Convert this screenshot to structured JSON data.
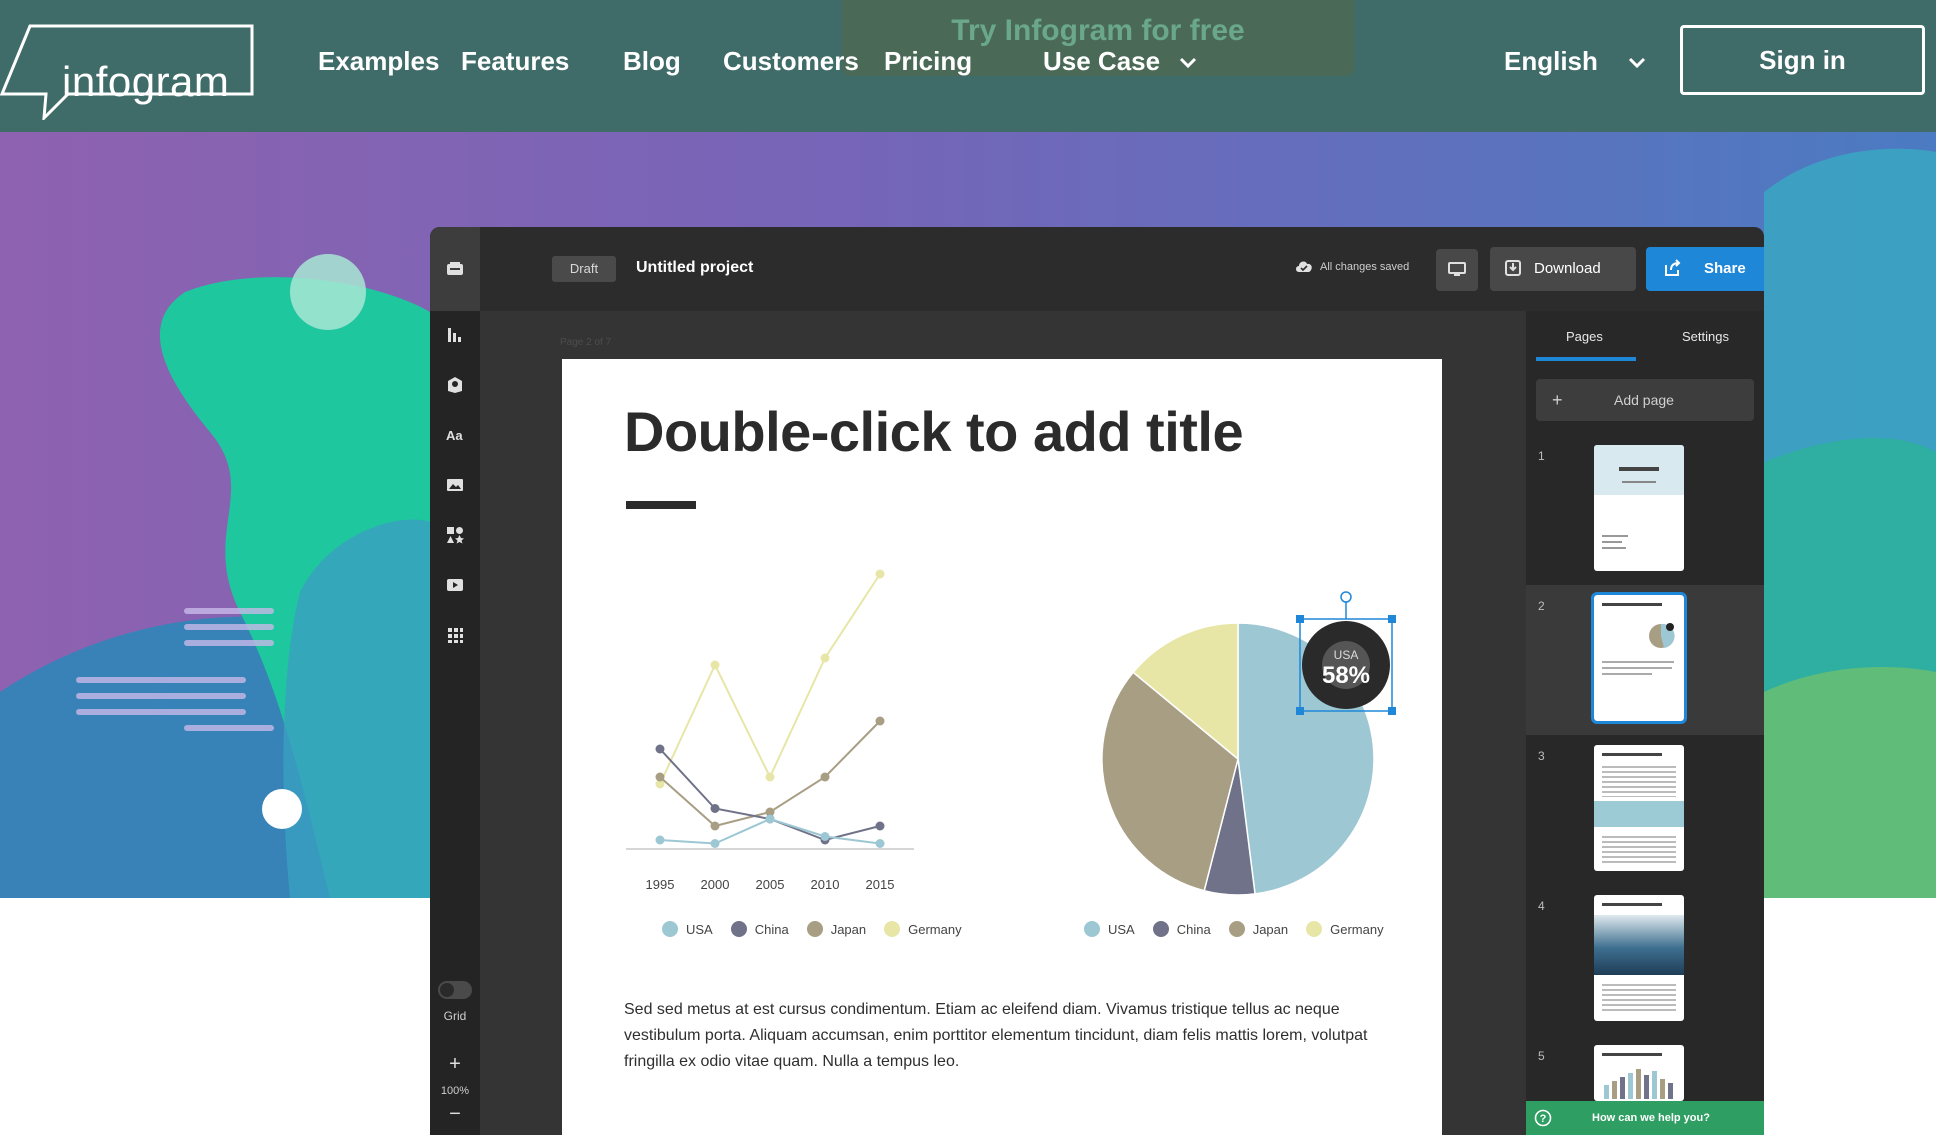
{
  "nav": {
    "logo": "infogram",
    "promo": "Try Infogram for free",
    "links": [
      "Examples",
      "Features",
      "Blog",
      "Customers",
      "Pricing",
      "Use Case"
    ],
    "language": "English",
    "sign_in": "Sign in"
  },
  "editor": {
    "status": "Draft",
    "project_title": "Untitled project",
    "saved_text": "All changes saved",
    "download_label": "Download",
    "share_label": "Share",
    "page_label": "Page 2 of 7",
    "grid_label": "Grid",
    "zoom": "100%",
    "zoom_plus": "+",
    "zoom_minus": "−"
  },
  "document": {
    "title": "Double-click to add title",
    "body": "Sed sed metus at est cursus condimentum. Etiam ac eleifend diam. Vivamus tristique tellus ac neque vestibulum porta. Aliquam accumsan, enim porttitor elementum tincidunt, diam felis mattis lorem, volutpat fringilla ex odio vitae quam. Nulla a tempus leo."
  },
  "colors": {
    "usa": "#9cc7d3",
    "china": "#6f7288",
    "japan": "#a89e84",
    "germany": "#e8e6a6",
    "accent": "#1f87d8",
    "help": "#2e9e62"
  },
  "chart_data": [
    {
      "type": "line",
      "x": [
        1995,
        2000,
        2005,
        2010,
        2015
      ],
      "series": [
        {
          "name": "USA",
          "values": [
            2,
            1,
            8,
            3,
            1
          ]
        },
        {
          "name": "China",
          "values": [
            28,
            11,
            8,
            2,
            6
          ]
        },
        {
          "name": "Japan",
          "values": [
            20,
            6,
            10,
            20,
            36
          ]
        },
        {
          "name": "Germany",
          "values": [
            18,
            52,
            20,
            54,
            78
          ]
        }
      ],
      "ylim": [
        0,
        80
      ],
      "grid": false,
      "legend": "bottom"
    },
    {
      "type": "pie",
      "labels": [
        "USA",
        "China",
        "Japan",
        "Germany"
      ],
      "values": [
        48,
        6,
        32,
        14
      ],
      "callout_label": "USA",
      "callout_value": "58%",
      "legend": "bottom"
    }
  ],
  "panel": {
    "tabs": [
      "Pages",
      "Settings"
    ],
    "add_page": "Add page",
    "thumbnails": [
      "1",
      "2",
      "3",
      "4",
      "5"
    ],
    "help": "How can we help you?"
  }
}
